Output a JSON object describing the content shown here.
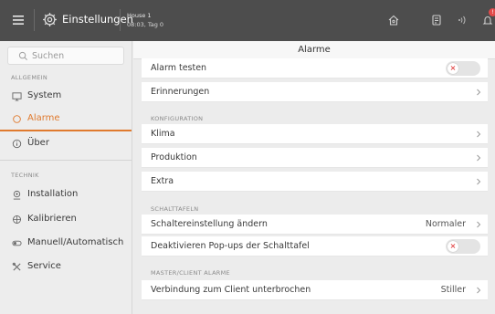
{
  "topbar": {
    "title": "Einstellungen",
    "house_name": "House 1",
    "house_time": "08:03, Tag 0",
    "bell_badge": "!"
  },
  "sidebar": {
    "search_placeholder": "Suchen",
    "section_general": "ALLGEMEIN",
    "section_tech": "TECHNIK",
    "items": [
      {
        "label": "System",
        "icon": "monitor-icon"
      },
      {
        "label": "Alarme",
        "icon": "alarm-icon",
        "active": true
      },
      {
        "label": "Über",
        "icon": "info-icon"
      },
      {
        "label": "Installation",
        "icon": "installation-icon"
      },
      {
        "label": "Kalibrieren",
        "icon": "calibrate-icon"
      },
      {
        "label": "Manuell/Automatisch",
        "icon": "manual-auto-icon"
      },
      {
        "label": "Service",
        "icon": "service-icon"
      }
    ]
  },
  "main": {
    "title": "Alarme",
    "rows": {
      "alarm_test": "Alarm testen",
      "reminders": "Erinnerungen",
      "climate": "Klima",
      "production": "Produktion",
      "extra": "Extra",
      "panel_setting": "Schaltereinstellung ändern",
      "panel_setting_value": "Normaler",
      "disable_popups": "Deaktivieren Pop-ups der Schalttafel",
      "client_lost": "Verbindung zum Client unterbrochen",
      "client_lost_value": "Stiller"
    },
    "sections": {
      "configuration": "KONFIGURATION",
      "panels": "SCHALTTAFELN",
      "master_client": "MASTER/CLIENT ALARME"
    },
    "toggle_mark": "×"
  },
  "colors": {
    "accent": "#e07a2e",
    "topbar": "#4d4d4d",
    "toggle_mark": "#e24a4a"
  }
}
